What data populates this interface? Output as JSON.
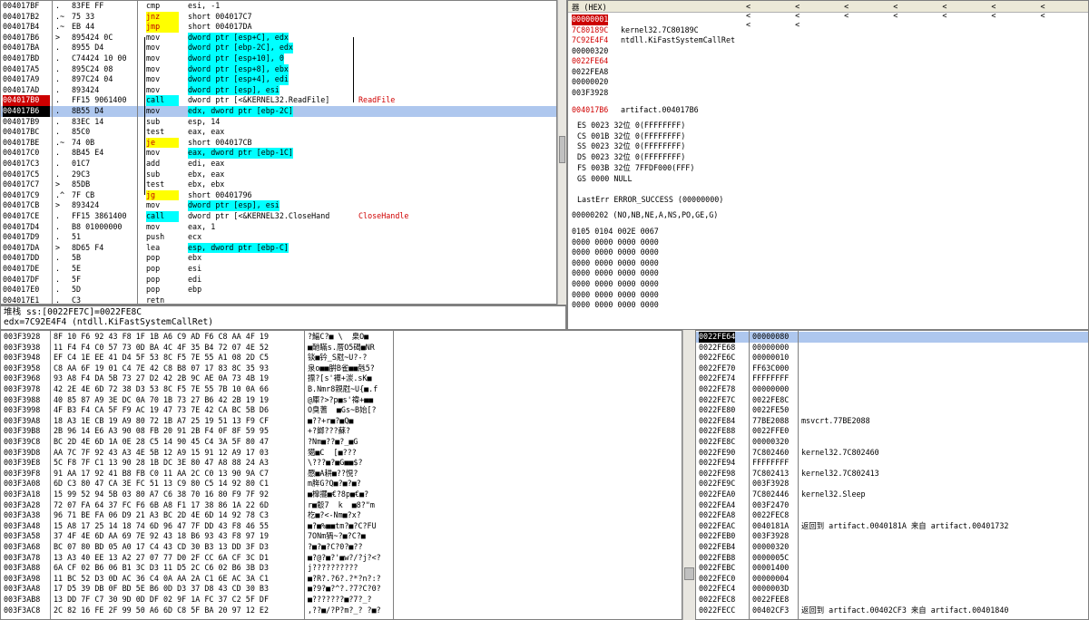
{
  "colors": {
    "breakpoint": "#cc0000",
    "eip": "#000000",
    "call_bg": "#00ffff",
    "jump_bg": "#ffff00",
    "selection": "#aec7ee",
    "modified_reg": "#d00000"
  },
  "disasm": {
    "rows": [
      {
        "addr": "004017BF",
        "m": ".",
        "hex": "83FE FF",
        "asm": "cmp",
        "ops": "esi, -1",
        "mt": ""
      },
      {
        "addr": "004017B2",
        "m": ".~",
        "hex": "75 33",
        "asm": "jnz",
        "ops": "short 004017C7",
        "mt": "yel"
      },
      {
        "addr": "004017B4",
        "m": ".~",
        "hex": "EB 44",
        "asm": "jmp",
        "ops": "short 004017DA",
        "mt": "yel"
      },
      {
        "addr": "004017B6",
        "m": ">",
        "hex": "895424 0C",
        "asm": "mov",
        "ops": "dword ptr [esp+C], edx",
        "mt": ""
      },
      {
        "addr": "004017BA",
        "m": ".",
        "hex": "8955 D4",
        "asm": "mov",
        "ops": "dword ptr [ebp-2C], edx",
        "mt": ""
      },
      {
        "addr": "004017BD",
        "m": ".",
        "hex": "C74424 10 00",
        "asm": "mov",
        "ops": "dword ptr [esp+10], 0",
        "mt": ""
      },
      {
        "addr": "004017A5",
        "m": ".",
        "hex": "895C24 08",
        "asm": "mov",
        "ops": "dword ptr [esp+8], ebx",
        "mt": ""
      },
      {
        "addr": "004017A9",
        "m": ".",
        "hex": "897C24 04",
        "asm": "mov",
        "ops": "dword ptr [esp+4], edi",
        "mt": ""
      },
      {
        "addr": "004017AD",
        "m": ".",
        "hex": "893424",
        "asm": "mov",
        "ops": "dword ptr [esp], esi",
        "mt": ""
      },
      {
        "addr": "004017B0",
        "m": ".",
        "hex": "FF15 9061400",
        "asm": "call",
        "ops": "dword ptr [<&KERNEL32.ReadFile]",
        "mt": "cyan",
        "cmt": "ReadFile"
      },
      {
        "addr": "004017B6",
        "m": ".",
        "hex": "8B55 D4",
        "asm": "mov",
        "ops": "edx, dword ptr [ebp-2C]",
        "mt": ""
      },
      {
        "addr": "004017B9",
        "m": ".",
        "hex": "83EC 14",
        "asm": "sub",
        "ops": "esp, 14",
        "mt": ""
      },
      {
        "addr": "004017BC",
        "m": ".",
        "hex": "85C0",
        "asm": "test",
        "ops": "eax, eax",
        "mt": ""
      },
      {
        "addr": "004017BE",
        "m": ".~",
        "hex": "74 0B",
        "asm": "je",
        "ops": "short 004017CB",
        "mt": "yel"
      },
      {
        "addr": "004017C0",
        "m": ".",
        "hex": "8B45 E4",
        "asm": "mov",
        "ops": "eax, dword ptr [ebp-1C]",
        "mt": ""
      },
      {
        "addr": "004017C3",
        "m": ".",
        "hex": "01C7",
        "asm": "add",
        "ops": "edi, eax",
        "mt": ""
      },
      {
        "addr": "004017C5",
        "m": ".",
        "hex": "29C3",
        "asm": "sub",
        "ops": "ebx, eax",
        "mt": ""
      },
      {
        "addr": "004017C7",
        "m": ">",
        "hex": "85DB",
        "asm": "test",
        "ops": "ebx, ebx",
        "mt": ""
      },
      {
        "addr": "004017C9",
        "m": ".^",
        "hex": "7F CB",
        "asm": "jg",
        "ops": "short 00401796",
        "mt": "yel"
      },
      {
        "addr": "004017CB",
        "m": ">",
        "hex": "893424",
        "asm": "mov",
        "ops": "dword ptr [esp], esi",
        "mt": ""
      },
      {
        "addr": "004017CE",
        "m": ".",
        "hex": "FF15 3861400",
        "asm": "call",
        "ops": "dword ptr [<&KERNEL32.CloseHand",
        "mt": "cyan",
        "cmt": "CloseHandle"
      },
      {
        "addr": "004017D4",
        "m": ".",
        "hex": "B8 01000000",
        "asm": "mov",
        "ops": "eax, 1",
        "mt": ""
      },
      {
        "addr": "004017D9",
        "m": ".",
        "hex": "51",
        "asm": "push",
        "ops": "ecx",
        "mt": ""
      },
      {
        "addr": "004017DA",
        "m": ">",
        "hex": "8D65 F4",
        "asm": "lea",
        "ops": "esp, dword ptr [ebp-C]",
        "mt": ""
      },
      {
        "addr": "004017DD",
        "m": ".",
        "hex": "5B",
        "asm": "pop",
        "ops": "ebx",
        "mt": ""
      },
      {
        "addr": "004017DE",
        "m": ".",
        "hex": "5E",
        "asm": "pop",
        "ops": "esi",
        "mt": ""
      },
      {
        "addr": "004017DF",
        "m": ".",
        "hex": "5F",
        "asm": "pop",
        "ops": "edi",
        "mt": ""
      },
      {
        "addr": "004017E0",
        "m": ".",
        "hex": "5D",
        "asm": "pop",
        "ops": "ebp",
        "mt": ""
      },
      {
        "addr": "004017E1",
        "m": ".",
        "hex": "C3",
        "asm": "retn",
        "ops": "",
        "mt": ""
      }
    ]
  },
  "info": {
    "line1": "堆栈 ss:[0022FE7C]=0022FE8C",
    "line2": "edx=7C92E4F4 (ntdll.KiFastSystemCallRet)"
  },
  "regs": {
    "title": "器 (HEX)",
    "arrows": "< < < < < < < < < < < < < < < <",
    "top": [
      {
        "v": "00000001",
        "c": "",
        "hl": true
      },
      {
        "v": "7C80189C",
        "c": "kernel32.7C80189C",
        "red": true
      },
      {
        "v": "7C92E4F4",
        "c": "ntdll.KiFastSystemCallRet",
        "red": true
      },
      {
        "v": "00000320",
        "c": ""
      },
      {
        "v": "0022FE64",
        "c": "",
        "red": true
      },
      {
        "v": "0022FEA8",
        "c": ""
      },
      {
        "v": "00000020",
        "c": ""
      },
      {
        "v": "003F3928",
        "c": ""
      }
    ],
    "eip": {
      "v": "004017B6",
      "c": "artifact.004017B6"
    },
    "segs": [
      "ES 0023 32位 0(FFFFFFFF)",
      "CS 001B 32位 0(FFFFFFFF)",
      "SS 0023 32位 0(FFFFFFFF)",
      "DS 0023 32位 0(FFFFFFFF)",
      "FS 003B 32位 7FFDF000(FFF)",
      "GS 0000 NULL"
    ],
    "lasterr": "LastErr ERROR_SUCCESS (00000000)",
    "efl": "00000202 (NO,NB,NE,A,NS,PO,GE,G)",
    "fpu": [
      "0105 0104 002E 0067",
      "0000 0000 0000 0000",
      "0000 0000 0000 0000",
      "0000 0000 0000 0000",
      "0000 0000 0000 0000",
      "0000 0000 0000 0000",
      "0000 0000 0000 0000",
      "0000 0000 0000 0000"
    ]
  },
  "dump": {
    "rows": [
      {
        "a": "003F3928",
        "h": "8F 10 F6 92 43 F8 1F 1B A6 C9 AD F6 C8 AA 4F 19",
        "t": "?鰏C?■ \\  臬O■"
      },
      {
        "a": "003F3938",
        "h": "11 F4 F4 C0 57 73 0D BA 4C 4F 35 B4 72 07 4E 52",
        "t": "■酏瞞s.厝O5碣■NR"
      },
      {
        "a": "003F3948",
        "h": "EF C4 1E EE 41 D4 5F 53 8C F5 7E 55 A1 08 2D C5",
        "t": "锬■钤_S屗~U?-?"
      },
      {
        "a": "003F3958",
        "h": "C8 AA 6F 19 01 C4 7E 42 C8 B8 07 17 83 8C 35 93",
        "t": "泉o■■腁B雀■■兞5?"
      },
      {
        "a": "003F3968",
        "h": "93 A8 F4 DA 5B 73 27 D2 42 2B 9C AE 0A 73 4B 19",
        "t": "摽?[s'襌+湠.sK■"
      },
      {
        "a": "003F3978",
        "h": "42 2E 4E 6D 72 38 D3 53 8C F5 7E 55 7B 10 0A 66",
        "t": "B.Nmr8親屗~U{■.f"
      },
      {
        "a": "003F3988",
        "h": "40 85 87 A9 3E DC 0A 70 1B 73 27 B6 42 2B 19 19",
        "t": "@厙?>?p■s'禕+■■"
      },
      {
        "a": "003F3998",
        "h": "4F B3 F4 CA 5F F9 AC 19 47 73 7E 42 CA BC 5B D6",
        "t": "O臭蓍  ■Gs~B始[?"
      },
      {
        "a": "003F39A8",
        "h": "18 A3 1E CB 19 A9 80 72 1B A7 25 19 51 13 F9 CF",
        "t": "■??+r■?■Q■"
      },
      {
        "a": "003F39B8",
        "h": "2B 96 14 E6 A3 90 08 FB 20 91 2B F4 0F 8F 59 95",
        "t": "+?鎯???蘇?"
      },
      {
        "a": "003F39C8",
        "h": "BC 2D 4E 6D 1A 0E 28 C5 14 90 45 C4 3A 5F 80 47",
        "t": "?Nm■??■?_■G"
      },
      {
        "a": "003F39D8",
        "h": "AA 7C 7F 92 43 A3 4E 5B 12 A9 15 91 12 A9 17 03",
        "t": "獦■C  [■???"
      },
      {
        "a": "003F39E8",
        "h": "5C F8 7F C1 13 90 28 1B DC 3E 80 47 A8 88 24 A3",
        "t": "\\???■?■G■■$?"
      },
      {
        "a": "003F39F8",
        "h": "91 AA 17 92 41 B8 FB C0 11 AA 2C C0 13 90 9A C7",
        "t": "憠■A耕■??悓?"
      },
      {
        "a": "003F3A08",
        "h": "6D C3 80 47 CA 3E FC 51 13 C9 80 C5 14 92 80 C1",
        "t": "m脌G?Q■?■?■?"
      },
      {
        "a": "003F3A18",
        "h": "15 99 52 94 5B 03 80 A7 C6 38 70 16 80 F9 7F 92",
        "t": "■橰擺■€?8p■€■?"
      },
      {
        "a": "003F3A28",
        "h": "72 07 FA 64 37 FC F6 6B A8 F1 17 38 86 1A 22 6D",
        "t": "r■鷇7  k  ■8?\"m"
      },
      {
        "a": "003F3A38",
        "h": "96 71 BE FA 06 D9 21 A3 BC 2D 4E 6D 14 92 78 C3",
        "t": "杚■?<-Nm■?x?"
      },
      {
        "a": "003F3A48",
        "h": "15 A8 17 25 14 18 74 6D 96 47 7F DD 43 F8 46 55",
        "t": "■?■%■■tm?■?C?FU"
      },
      {
        "a": "003F3A58",
        "h": "37 4F 4E 6D AA 69 7E 92 43 18 B6 93 43 F8 97 19",
        "t": "7ONm猧~?■?C?■"
      },
      {
        "a": "003F3A68",
        "h": "BC 07 80 BD 05 A0 17 C4 43 CD 30 B3 13 DD 3F D3",
        "t": "?■?■?C?0?■??"
      },
      {
        "a": "003F3A78",
        "h": "13 A3 40 EE 13 A2 27 07 77 D0 2F CC 6A CF 3C D1",
        "t": "■?@?■?'■w?/?j?<?"
      },
      {
        "a": "003F3A88",
        "h": "6A CF 02 B6 06 B1 3C D3 11 D5 2C C6 02 B6 3B D3",
        "t": "j??????????"
      },
      {
        "a": "003F3A98",
        "h": "11 BC 52 D3 0D AC 36 C4 0A AA 2A C1 6E AC 3A C1",
        "t": "■?R?.?6?.?*?n?:?"
      },
      {
        "a": "003F3AA8",
        "h": "17 D5 39 DB 0F BD 5E B6 0D D3 37 D8 43 CD 30 B3",
        "t": "■?9?■?^?.?7?C?0?"
      },
      {
        "a": "003F3AB8",
        "h": "13 DD 7F C7 30 9D 0D DF 02 9F 1A FC 37 C2 5F DF",
        "t": "■???????■?7?_?"
      },
      {
        "a": "003F3AC8",
        "h": "2C 82 16 FE 2F 99 50 A6 6D C8 5F BA 20 97 12 E2",
        "t": ",??■/?P?m?_? ?■?"
      }
    ]
  },
  "stack": {
    "rows": [
      {
        "a": "0022FE64",
        "v": "00000080",
        "c": "",
        "hl": true
      },
      {
        "a": "0022FE68",
        "v": "00000000",
        "c": ""
      },
      {
        "a": "0022FE6C",
        "v": "00000010",
        "c": ""
      },
      {
        "a": "0022FE70",
        "v": "FF63C000",
        "c": ""
      },
      {
        "a": "0022FE74",
        "v": "FFFFFFFF",
        "c": ""
      },
      {
        "a": "0022FE78",
        "v": "00000000",
        "c": ""
      },
      {
        "a": "0022FE7C",
        "v": "0022FE8C",
        "c": ""
      },
      {
        "a": "0022FE80",
        "v": "0022FE50",
        "c": ""
      },
      {
        "a": "0022FE84",
        "v": "77BE2088",
        "c": "msvcrt.77BE2088"
      },
      {
        "a": "0022FE88",
        "v": "0022FFE0",
        "c": ""
      },
      {
        "a": "0022FE8C",
        "v": "00000320",
        "c": ""
      },
      {
        "a": "0022FE90",
        "v": "7C802460",
        "c": "kernel32.7C802460"
      },
      {
        "a": "0022FE94",
        "v": "FFFFFFFF",
        "c": ""
      },
      {
        "a": "0022FE98",
        "v": "7C802413",
        "c": "kernel32.7C802413"
      },
      {
        "a": "0022FE9C",
        "v": "003F3928",
        "c": ""
      },
      {
        "a": "0022FEA0",
        "v": "7C802446",
        "c": "kernel32.Sleep"
      },
      {
        "a": "0022FEA4",
        "v": "003F2470",
        "c": ""
      },
      {
        "a": "0022FEA8",
        "v": "0022FEC8",
        "c": ""
      },
      {
        "a": "0022FEAC",
        "v": "0040181A",
        "c": "返回到 artifact.0040181A 来自 artifact.00401732"
      },
      {
        "a": "0022FEB0",
        "v": "003F3928",
        "c": ""
      },
      {
        "a": "0022FEB4",
        "v": "00000320",
        "c": ""
      },
      {
        "a": "0022FEB8",
        "v": "0000005C",
        "c": ""
      },
      {
        "a": "0022FEBC",
        "v": "00001400",
        "c": ""
      },
      {
        "a": "0022FEC0",
        "v": "00000004",
        "c": ""
      },
      {
        "a": "0022FEC4",
        "v": "0000003D",
        "c": ""
      },
      {
        "a": "0022FEC8",
        "v": "0022FEE8",
        "c": ""
      },
      {
        "a": "0022FECC",
        "v": "00402CF3",
        "c": "返回到 artifact.00402CF3 来自 artifact.00401840"
      }
    ]
  }
}
